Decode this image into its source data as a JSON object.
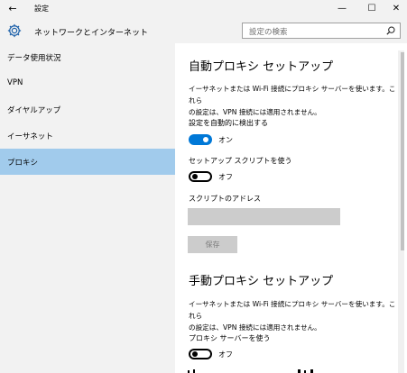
{
  "window": {
    "title": "設定",
    "back_icon": "←",
    "minimize_icon": "—",
    "maximize_icon": "☐",
    "close_icon": "✕"
  },
  "header": {
    "title": "ネットワークとインターネット",
    "search_placeholder": "設定の検索"
  },
  "sidebar": {
    "items": [
      {
        "label": "データ使用状況"
      },
      {
        "label": "VPN"
      },
      {
        "label": "ダイヤルアップ"
      },
      {
        "label": "イーサネット"
      },
      {
        "label": "プロキシ",
        "selected": true
      }
    ]
  },
  "auto_proxy": {
    "title": "自動プロキシ セットアップ",
    "description_line1": "イーサネットまたは Wi-Fi 接続にプロキシ サーバーを使います。これら",
    "description_line2": "の設定は、VPN 接続には適用されません。",
    "detect_label": "設定を自動的に検出する",
    "detect_state": "オン",
    "detect_on": true,
    "script_label": "セットアップ スクリプトを使う",
    "script_state": "オフ",
    "script_on": false,
    "address_label": "スクリプトのアドレス",
    "address_value": "",
    "save_label": "保存"
  },
  "manual_proxy": {
    "title": "手動プロキシ セットアップ",
    "description_line1": "イーサネットまたは Wi-Fi 接続にプロキシ サーバーを使います。これら",
    "description_line2": "の設定は、VPN 接続には適用されません。",
    "use_label": "プロキシ サーバーを使う",
    "use_state": "オフ",
    "use_on": false
  },
  "colors": {
    "accent": "#0078d7",
    "selected_nav": "#a1cbec",
    "chrome_bg": "#f2f2f2",
    "disabled": "#cccccc"
  }
}
